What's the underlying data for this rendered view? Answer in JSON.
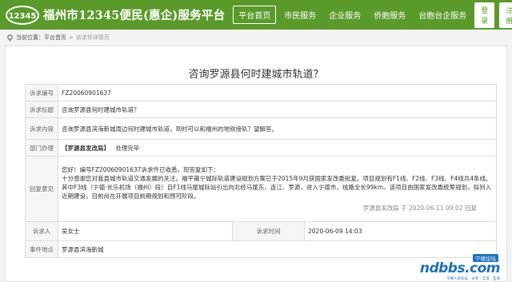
{
  "header": {
    "logo_text": "12345",
    "site_title": "福州市12345便民(惠企)服务平台",
    "nav": [
      "平台首页",
      "市民服务",
      "企业服务",
      "侨胞服务",
      "台胞台企服务"
    ],
    "login_label": "登录",
    "register_label": "注册",
    "accent_color": "#5a9a2a"
  },
  "breadcrumb": {
    "prefix": "当前位置：",
    "home": "平台首页",
    "current": "诉求件详情页"
  },
  "page_title": "咨询罗源县何时建城市轨道？",
  "detail": {
    "number_label": "诉求编号",
    "number": "FZ20060901637",
    "subject_label": "诉求标题",
    "subject": "咨询罗源县何时建城市轨道？",
    "content_label": "诉求内容",
    "content": "咨询罗源县滨海新城周边何时建城市轨道，到时可以和福州的地铁接轨？望解答。",
    "handling_label": "部门办理",
    "handling_dept": "【罗源县发改局】",
    "handling_status": "处理完毕",
    "reply_label": "回复意见",
    "reply_lines": [
      "您好！编号FZ20060901637诉求件已收悉，现答复如下：",
      "十分感谢您对我县城市轨道交通发展的关注。福平莆宁城际轨道建设规划方案已于2015年9月获国家发改委批复。项目规划有F1线、F2线、F3线、F4线共4条线。",
      "其中F3线（宁德-长乐机场（福州）段）自F1线马尾城际站引出向北经马尾东、连江、罗源，进入宁德市，线路全长99km。该项目由国家发改委统筹规划，拟列入近期建设，目前尚在开展项目前期规划和预可阶段。"
    ],
    "reply_sign": "罗源县发改局 于 2020-06-11 09:02 回复",
    "petitioner_label": "诉求人",
    "petitioner": "吴女士",
    "time_label": "诉求时间",
    "time": "2020-06-09 14:03",
    "location_label": "事件地点",
    "location": "罗源县滨海新城"
  },
  "watermark": {
    "main": "ndbbs.com",
    "badge": "宁德论坛",
    "sub": "宁德人的论坛 · 分享 · 交流 · 互动"
  }
}
